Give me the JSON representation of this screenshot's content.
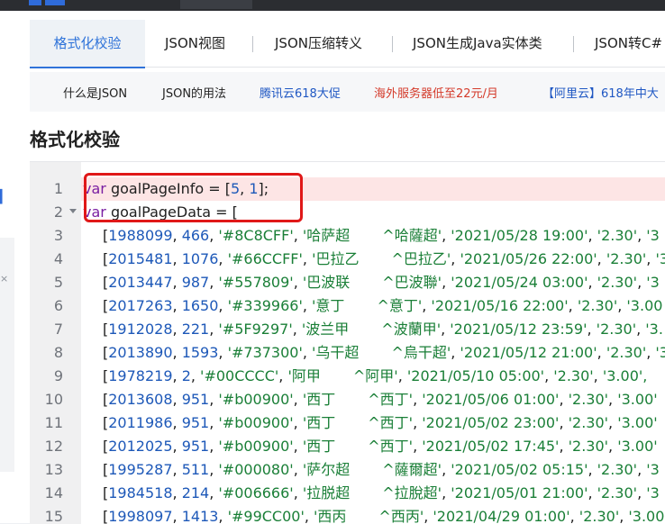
{
  "tabs": [
    {
      "label": "格式化校验",
      "active": true
    },
    {
      "label": "JSON视图"
    },
    {
      "label": "JSON压缩转义"
    },
    {
      "label": "JSON生成Java实体类"
    },
    {
      "label": "JSON转C#"
    }
  ],
  "links": [
    {
      "label": "什么是JSON",
      "color": "dark"
    },
    {
      "label": "JSON的用法",
      "color": "dark"
    },
    {
      "label": "腾讯云618大促",
      "color": "blue"
    },
    {
      "label": "海外服务器低至22元/月",
      "color": "red"
    },
    {
      "label": "【阿里云】618年中大",
      "color": "blue"
    }
  ],
  "section_title": "格式化校验",
  "editor": {
    "line_numbers": [
      "1",
      "2",
      "3",
      "4",
      "5",
      "6",
      "7",
      "8",
      "9",
      "10",
      "11",
      "12",
      "13",
      "14",
      "15"
    ],
    "line1": {
      "kw": "var",
      "rest": " goalPageInfo = [",
      "a": "5",
      "sep": ", ",
      "b": "1",
      "end": "];"
    },
    "line2": {
      "kw": "var",
      "rest": " goalPageData = ["
    },
    "rows": [
      {
        "id": "1988099",
        "n": "466",
        "color": "'#8C8CFF'",
        "name": "'哈萨超",
        "trad": "^哈薩超'",
        "date": "'2021/05/28 19:00'",
        "v": "'2.30'",
        "tail": "'3"
      },
      {
        "id": "2015481",
        "n": "1076",
        "color": "'#66CCFF'",
        "name": "'巴拉乙",
        "trad": "^巴拉乙'",
        "date": "'2021/05/26 22:00'",
        "v": "'2.30'",
        "tail": "'3"
      },
      {
        "id": "2013447",
        "n": "987",
        "color": "'#557809'",
        "name": "'巴波联",
        "trad": "^巴波聯'",
        "date": "'2021/05/24 03:00'",
        "v": "'2.30'",
        "tail": "'3"
      },
      {
        "id": "2017263",
        "n": "1650",
        "color": "'#339966'",
        "name": "'意丁",
        "trad": "^意丁'",
        "date": "'2021/05/16 22:00'",
        "v": "'2.30'",
        "tail": "'3.00"
      },
      {
        "id": "1912028",
        "n": "221",
        "color": "'#5F9297'",
        "name": "'波兰甲",
        "trad": "^波蘭甲'",
        "date": "'2021/05/12 23:59'",
        "v": "'2.30'",
        "tail": "'3."
      },
      {
        "id": "2013890",
        "n": "1593",
        "color": "'#737300'",
        "name": "'乌干超",
        "trad": "^烏干超'",
        "date": "'2021/05/12 21:00'",
        "v": "'2.30'",
        "tail": "'3"
      },
      {
        "id": "1978219",
        "n": "2",
        "color": "'#00CCCC'",
        "name": "'阿甲",
        "trad": "^阿甲'",
        "date": "'2021/05/10 05:00'",
        "v": "'2.30'",
        "tail": "'3.00',"
      },
      {
        "id": "2013608",
        "n": "951",
        "color": "'#b00900'",
        "name": "'西丁",
        "trad": "^西丁'",
        "date": "'2021/05/06 01:00'",
        "v": "'2.30'",
        "tail": "'3.00'"
      },
      {
        "id": "2011986",
        "n": "951",
        "color": "'#b00900'",
        "name": "'西丁",
        "trad": "^西丁'",
        "date": "'2021/05/02 23:00'",
        "v": "'2.30'",
        "tail": "'3.00'"
      },
      {
        "id": "2012025",
        "n": "951",
        "color": "'#b00900'",
        "name": "'西丁",
        "trad": "^西丁'",
        "date": "'2021/05/02 17:45'",
        "v": "'2.30'",
        "tail": "'3.00'"
      },
      {
        "id": "1995287",
        "n": "511",
        "color": "'#000080'",
        "name": "'萨尔超",
        "trad": "^薩爾超'",
        "date": "'2021/05/02 05:15'",
        "v": "'2.30'",
        "tail": "'3"
      },
      {
        "id": "1984518",
        "n": "214",
        "color": "'#006666'",
        "name": "'拉脱超",
        "trad": "^拉脫超'",
        "date": "'2021/05/01 21:00'",
        "v": "'2.30'",
        "tail": "'3"
      },
      {
        "id": "1998097",
        "n": "1413",
        "color": "'#99CC00'",
        "name": "'西丙",
        "trad": "^西丙'",
        "date": "'2021/04/29 01:00'",
        "v": "'2.30'",
        "tail": "'3.00"
      }
    ]
  }
}
